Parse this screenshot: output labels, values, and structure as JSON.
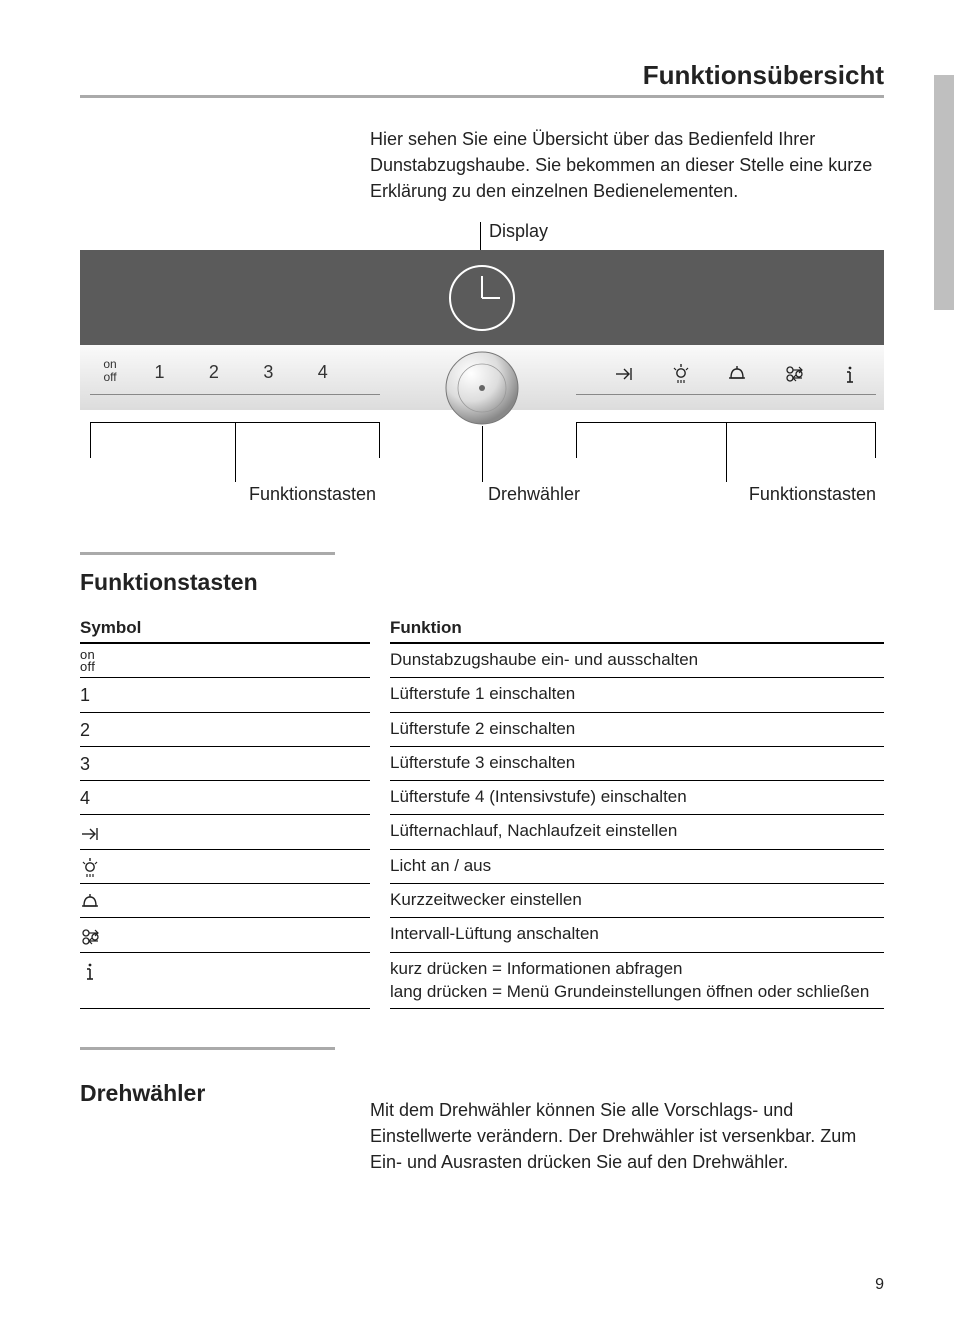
{
  "page_title": "Funktionsübersicht",
  "intro": "Hier sehen Sie eine Übersicht über das Bedienfeld Ihrer Dunstabzugshaube. Sie bekommen an dieser Stelle eine kurze Erklärung zu den einzelnen Bedienelementen.",
  "diagram": {
    "display_label": "Display",
    "funktionstasten_label_left": "Funktionstasten",
    "drehwahler_label": "Drehwähler",
    "funktionstasten_label_right": "Funktionstasten",
    "buttons_left": {
      "onoff_top": "on",
      "onoff_bottom": "off",
      "b1": "1",
      "b2": "2",
      "b3": "3",
      "b4": "4"
    },
    "buttons_right_icons": [
      "arrow-right-stop",
      "light",
      "bell",
      "interval",
      "info"
    ]
  },
  "section_funktionstasten": "Funktionstasten",
  "table": {
    "head_symbol": "Symbol",
    "head_funktion": "Funktion",
    "rows": [
      {
        "symbol_type": "onoff",
        "symbol_top": "on",
        "symbol_bottom": "off",
        "funktion": "Dunstabzugshaube ein- und ausschalten"
      },
      {
        "symbol_type": "text",
        "symbol": "1",
        "funktion": "Lüfterstufe 1 einschalten"
      },
      {
        "symbol_type": "text",
        "symbol": "2",
        "funktion": "Lüfterstufe 2 einschalten"
      },
      {
        "symbol_type": "text",
        "symbol": "3",
        "funktion": "Lüfterstufe 3 einschalten"
      },
      {
        "symbol_type": "text",
        "symbol": "4",
        "funktion": "Lüfterstufe 4 (Intensivstufe) einschalten"
      },
      {
        "symbol_type": "icon",
        "icon": "arrow-right-stop",
        "funktion": "Lüfternachlauf, Nachlaufzeit einstellen"
      },
      {
        "symbol_type": "icon",
        "icon": "light",
        "funktion": "Licht an / aus"
      },
      {
        "symbol_type": "icon",
        "icon": "bell",
        "funktion": "Kurzzeitwecker einstellen"
      },
      {
        "symbol_type": "icon",
        "icon": "interval",
        "funktion": "Intervall-Lüftung anschalten"
      },
      {
        "symbol_type": "icon",
        "icon": "info",
        "funktion": "kurz drücken = Informationen abfragen\nlang drücken = Menü Grundeinstellungen öffnen oder schließen"
      }
    ]
  },
  "section_drehwahler": "Drehwähler",
  "drehwahler_text": "Mit dem Drehwähler können Sie alle Vorschlags- und Einstellwerte verändern. Der Drehwähler ist versenkbar. Zum Ein- und Ausrasten drücken Sie auf den Drehwähler.",
  "page_number": "9"
}
